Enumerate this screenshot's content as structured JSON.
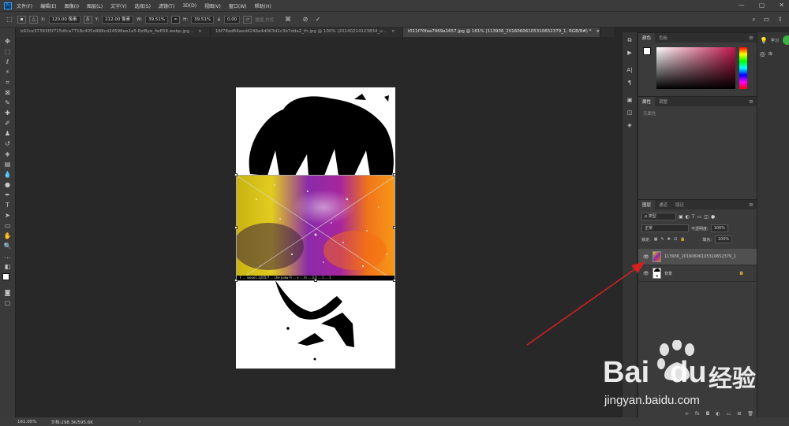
{
  "app": {
    "logo_text": "Ps"
  },
  "menu": [
    "文件(F)",
    "编辑(E)",
    "图像(I)",
    "图层(L)",
    "文字(Y)",
    "选择(S)",
    "滤镜(T)",
    "3D(D)",
    "视图(V)",
    "窗口(W)",
    "帮助(H)"
  ],
  "options": {
    "x_label": "X:",
    "x_value": "120.00 像素",
    "y_label": "Y:",
    "y_value": "212.00 像素",
    "w_label": "W:",
    "w_value": "39.51%",
    "h_label": "H:",
    "h_value": "39.51%",
    "angle_label": "∡",
    "angle_value": "0.00",
    "interp": "插值 方式",
    "warp": "变形"
  },
  "tabs": [
    {
      "label": "b92ce37393f5f715dfca7718c405d488cd24596ee1a5-RzlBye_fw658.webp.jpg...",
      "close": "×"
    },
    {
      "label": "16f78ad64aed4246a4d063d2c3b7dda2_th.jpg @ 100% (20140214123834_u...",
      "close": "×"
    },
    {
      "label": "t011f70faa7969a1657.jpg @ 161% (113936_20160606105310652379_1, RGB/8#) *",
      "close": "×"
    }
  ],
  "doc_caption": "F ... ixooo1.3205/7 ... Lhe Juaw Fi ... v ... m ... 3.0 ... 1 ... 1",
  "status": {
    "zoom": "161.05%",
    "doc": "文档:298.3K/595.6K",
    "arrow": "›"
  },
  "color_panel": {
    "tabs": [
      "颜色",
      "色板"
    ],
    "hue_color": "#c0154a"
  },
  "props_panel": {
    "tabs": [
      "属性",
      "调整"
    ],
    "empty_text": "无属性"
  },
  "layers_panel": {
    "tabs": [
      "图层",
      "通道",
      "路径"
    ],
    "filter_label": "ρ 类型",
    "blend_mode": "正常",
    "opacity_label": "不透明度:",
    "opacity_value": "100%",
    "lock_label": "锁定:",
    "fill_label": "填充:",
    "fill_value": "100%",
    "layers": [
      {
        "name": "113936_20160606105310652379_1",
        "selected": true
      },
      {
        "name": "背景",
        "lock": "🔒"
      }
    ]
  },
  "right_col": {
    "learn": "学习",
    "library": "库"
  },
  "watermark": {
    "brand_a": "Bai",
    "brand_b": "du",
    "cn": "经验",
    "url": "jingyan.baidu.com"
  },
  "colors": {
    "accent": "#31a8ff",
    "arrow": "#d32020",
    "bg_dark": "#282828",
    "panel": "#3b3b3b"
  }
}
